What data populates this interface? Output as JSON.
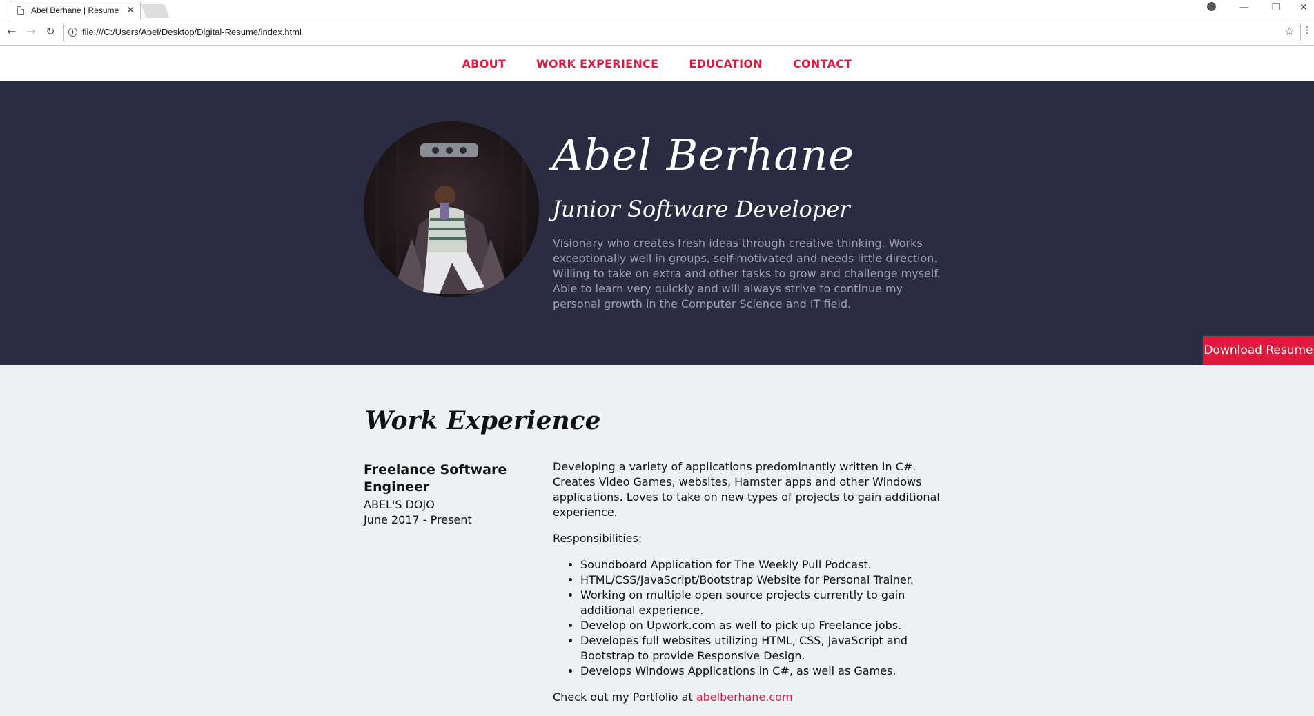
{
  "browser": {
    "tab_title": "Abel Berhane | Resume",
    "tab_close": "✕",
    "url": "file:///C:/Users/Abel/Desktop/Digital-Resume/index.html",
    "controls": {
      "minimize": "—",
      "restore": "❐",
      "close": "✕",
      "back": "←",
      "forward": "→",
      "reload": "↻",
      "star": "☆",
      "menu": "⋮",
      "info": "i"
    }
  },
  "nav": {
    "items": [
      "ABOUT",
      "WORK EXPERIENCE",
      "EDUCATION",
      "CONTACT"
    ]
  },
  "hero": {
    "name": "Abel Berhane",
    "title": "Junior Software Developer",
    "bio": "Visionary who creates fresh ideas through creative thinking. Works exceptionally well in groups, self-motivated and needs little direction. Willing to take on extra and other tasks to grow and challenge myself. Able to learn very quickly and will always strive to continue my personal growth in the Computer Science and IT field.",
    "download_label": "Download Resume"
  },
  "work": {
    "section_title": "Work Experience",
    "job": {
      "title": "Freelance Software Engineer",
      "company": "ABEL'S DOJO",
      "dates": "June 2017 - Present",
      "summary": "Developing a variety of applications predominantly written in C#. Creates Video Games, websites, Hamster apps and other Windows applications. Loves to take on new types of projects to gain additional experience.",
      "responsibilities_label": "Responsibilities:",
      "responsibilities": [
        "Soundboard Application for The Weekly Pull Podcast.",
        "HTML/CSS/JavaScript/Bootstrap Website for Personal Trainer.",
        "Working on multiple open source projects currently to gain additional experience.",
        "Develop on Upwork.com as well to pick up Freelance jobs.",
        "Developes full websites utilizing HTML, CSS, JavaScript and Bootstrap to provide Responsive Design.",
        "Develops Windows Applications in C#, as well as Games."
      ],
      "portfolio_prefix": "Check out my Portfolio at ",
      "portfolio_link": "abelberhane.com"
    }
  },
  "colors": {
    "accent": "#e0193f",
    "hero_bg": "#2a2c42",
    "page_bg": "#edf1f4",
    "bio_text": "#9aa0b8"
  }
}
